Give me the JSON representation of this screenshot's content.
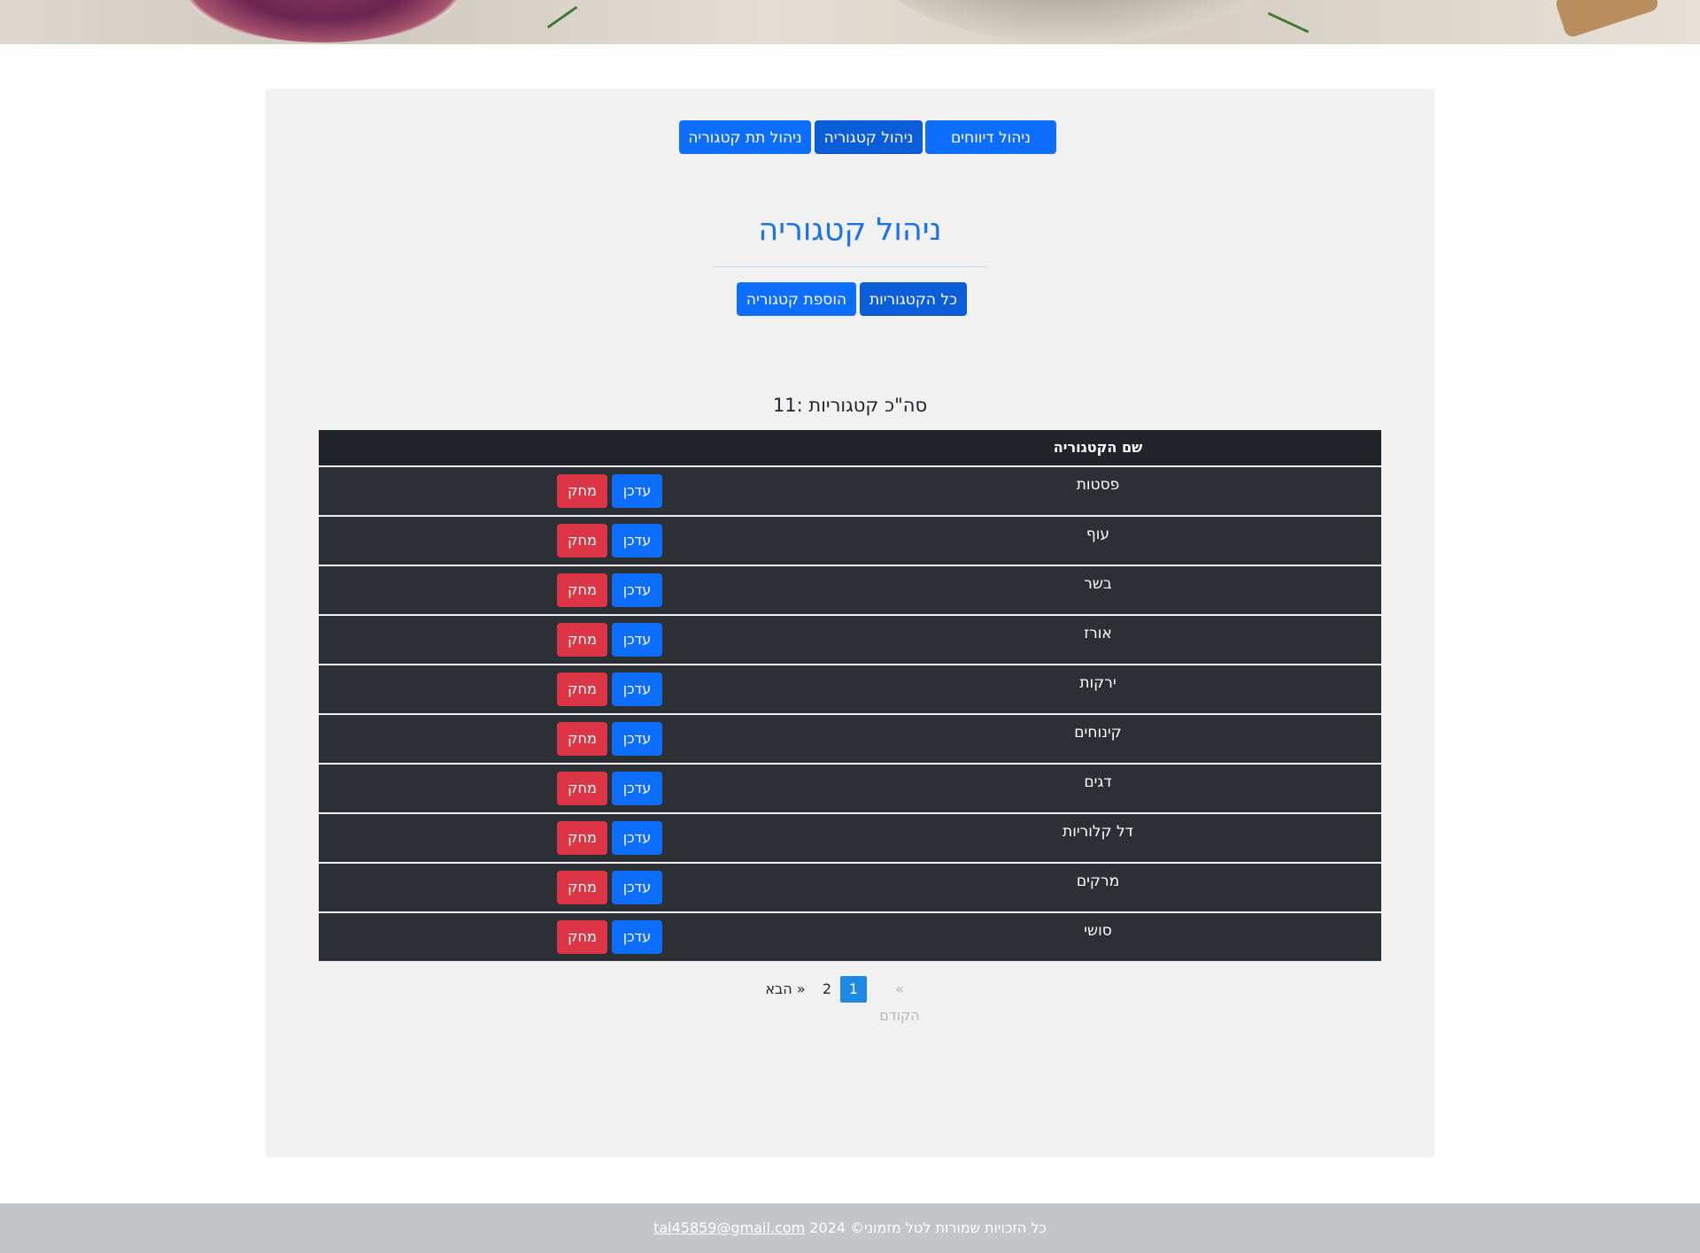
{
  "nav": {
    "reports": "ניהול דיווחים",
    "category": "ניהול קטגוריה",
    "subcategory": "ניהול תת קטגוריה"
  },
  "page_title": "ניהול קטגוריה",
  "actions": {
    "all_categories": "כל הקטגוריות",
    "add_category": "הוספת קטגוריה"
  },
  "total_label": "סה\"כ קטגוריות :11",
  "table": {
    "header": "שם הקטגוריה",
    "edit_label": "עדכן",
    "delete_label": "מחק",
    "rows": [
      "פסטות",
      "עוף",
      "בשר",
      "אורז",
      "ירקות",
      "קינוחים",
      "דגים",
      "דל קלוריות",
      "מרקים",
      "סושי"
    ]
  },
  "pagination": {
    "prev": "« הקודם",
    "pages": [
      "1",
      "2"
    ],
    "current": "1",
    "next": "הבא »"
  },
  "footer": {
    "text": "כל הזכויות שמורות לטל מזמוני© 2024",
    "email": "tal45859@gmail.com"
  },
  "colors": {
    "primary": "#0d6efd",
    "danger": "#dc3545",
    "table_dark": "#212529",
    "title": "#1a73e8"
  }
}
